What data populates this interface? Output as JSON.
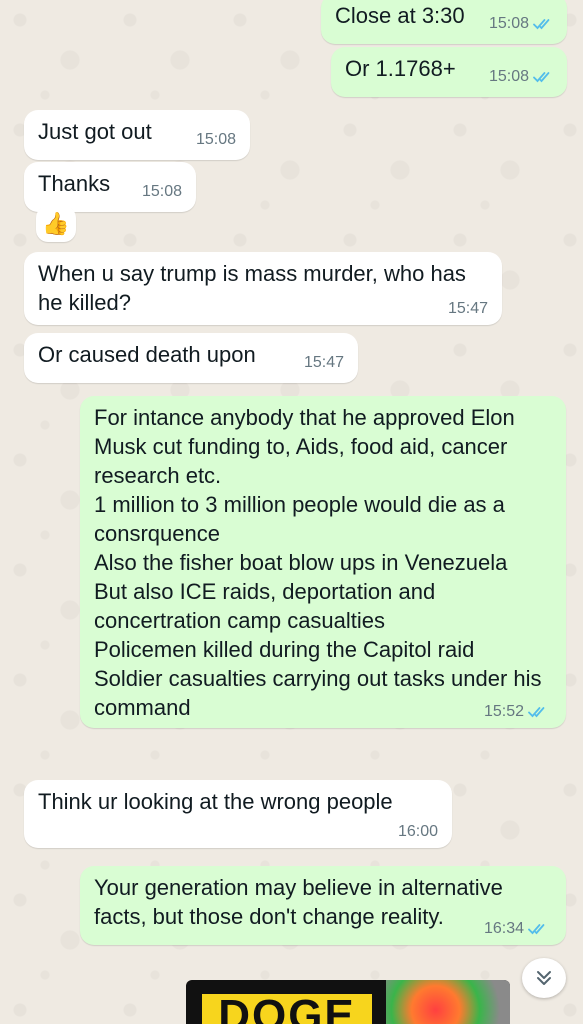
{
  "chat": {
    "messages": [
      {
        "direction": "out",
        "text": "Close at 3:30",
        "time": "15:08",
        "read": true
      },
      {
        "direction": "out",
        "text": "Or 1.1768+",
        "time": "15:08",
        "read": true
      },
      {
        "direction": "in",
        "text": "Just got out",
        "time": "15:08"
      },
      {
        "direction": "in",
        "text": "Thanks",
        "time": "15:08"
      },
      {
        "direction": "in",
        "text": "When u say trump is mass murder, who has he killed?",
        "time": "15:47"
      },
      {
        "direction": "in",
        "text": "Or caused death upon",
        "time": "15:47"
      },
      {
        "direction": "out",
        "text": "For intance anybody that he approved Elon Musk cut funding to, Aids, food aid, cancer research etc.\n1 million to 3 million people would die as a consrquence\nAlso the fisher boat blow ups in Venezuela\nBut also ICE raids, deportation and concertration camp casualties\nPolicemen killed during the Capitol raid\nSoldier casualties carrying out tasks under his command",
        "time": "15:52",
        "read": true
      },
      {
        "direction": "in",
        "text": "Think ur looking at the wrong people",
        "time": "16:00"
      },
      {
        "direction": "out",
        "text": "Your generation may believe in alternative facts, but those don't change reality.",
        "time": "16:34",
        "read": true
      }
    ],
    "reaction": {
      "emoji": "👍"
    },
    "media_preview": {
      "text": "DOGE"
    },
    "icons": {
      "read_receipt": "double-check-icon",
      "scroll_down": "double-chevron-down-icon"
    },
    "colors": {
      "outgoing_bubble": "#d9fdd3",
      "incoming_bubble": "#ffffff",
      "background": "#efeae2",
      "read_tick": "#53bdeb",
      "timestamp": "#667781"
    }
  }
}
